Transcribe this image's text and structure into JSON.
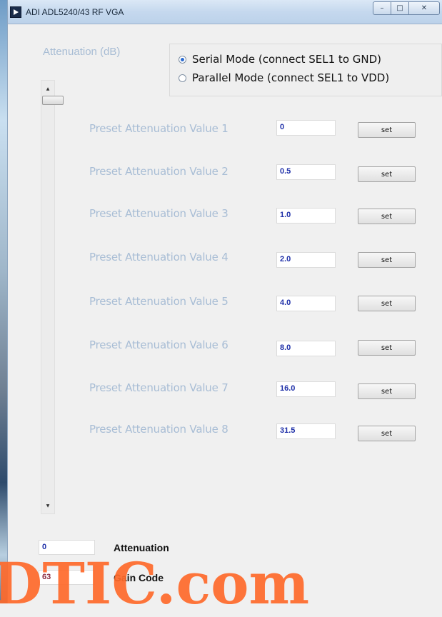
{
  "window": {
    "title": "ADI ADL5240/43 RF VGA",
    "controls": {
      "minimize": "–",
      "maximize": "□",
      "close": "✕"
    }
  },
  "attenuation_label": "Attenuation (dB)",
  "mode": {
    "serial_label": "Serial Mode (connect SEL1 to GND)",
    "parallel_label": "Parallel Mode (connect SEL1 to VDD)",
    "selected": "serial"
  },
  "slider": {
    "up_arrow": "▲",
    "down_arrow": "▼"
  },
  "presets": [
    {
      "label": "Preset Attenuation Value 1",
      "value": "0",
      "button": "set"
    },
    {
      "label": "Preset Attenuation Value 2",
      "value": "0.5",
      "button": "set"
    },
    {
      "label": "Preset Attenuation Value 3",
      "value": "1.0",
      "button": "set"
    },
    {
      "label": "Preset Attenuation Value 4",
      "value": "2.0",
      "button": "set"
    },
    {
      "label": "Preset Attenuation Value 5",
      "value": "4.0",
      "button": "set"
    },
    {
      "label": "Preset Attenuation Value 6",
      "value": "8.0",
      "button": "set"
    },
    {
      "label": "Preset Attenuation Value 7",
      "value": "16.0",
      "button": "set"
    },
    {
      "label": "Preset Attenuation Value 8",
      "value": "31.5",
      "button": "set"
    }
  ],
  "readout": {
    "attenuation_value": "0",
    "attenuation_label": "Attenuation",
    "gain_code_value": "63",
    "gain_code_label": "Gain Code"
  },
  "watermark": "DTIC.com",
  "colors": {
    "preset_label": "#a8bdd5",
    "input_text": "#1e2fa8",
    "gain_code_text": "#8a2b3f",
    "watermark": "#ff6a2b"
  }
}
